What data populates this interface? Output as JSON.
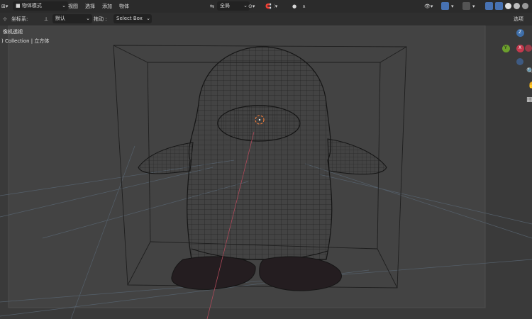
{
  "header": {
    "mode_label": "物体模式",
    "menu": [
      "视图",
      "选择",
      "添加",
      "物体"
    ],
    "transform_orientation": "全局",
    "right_label": "选项"
  },
  "toolbar": {
    "coord_label": "坐标系:",
    "coord_value": "默认",
    "drag_label": "拖动 :",
    "drag_value": "Select Box"
  },
  "viewport": {
    "view_name": "像机透视",
    "collection_path": ") Collection | 立方体"
  },
  "gizmo": {
    "x_label": "X",
    "y_label": "Y",
    "z_label": "Z"
  },
  "colors": {
    "header_bg": "#2b2b2b",
    "viewport_bg": "#3d3d3d",
    "camera_frame": "#555555",
    "accent_blue": "#4772b3",
    "axis_red": "#c4394d",
    "axis_green": "#6c9f2d",
    "axis_blue": "#3e6ea8"
  }
}
